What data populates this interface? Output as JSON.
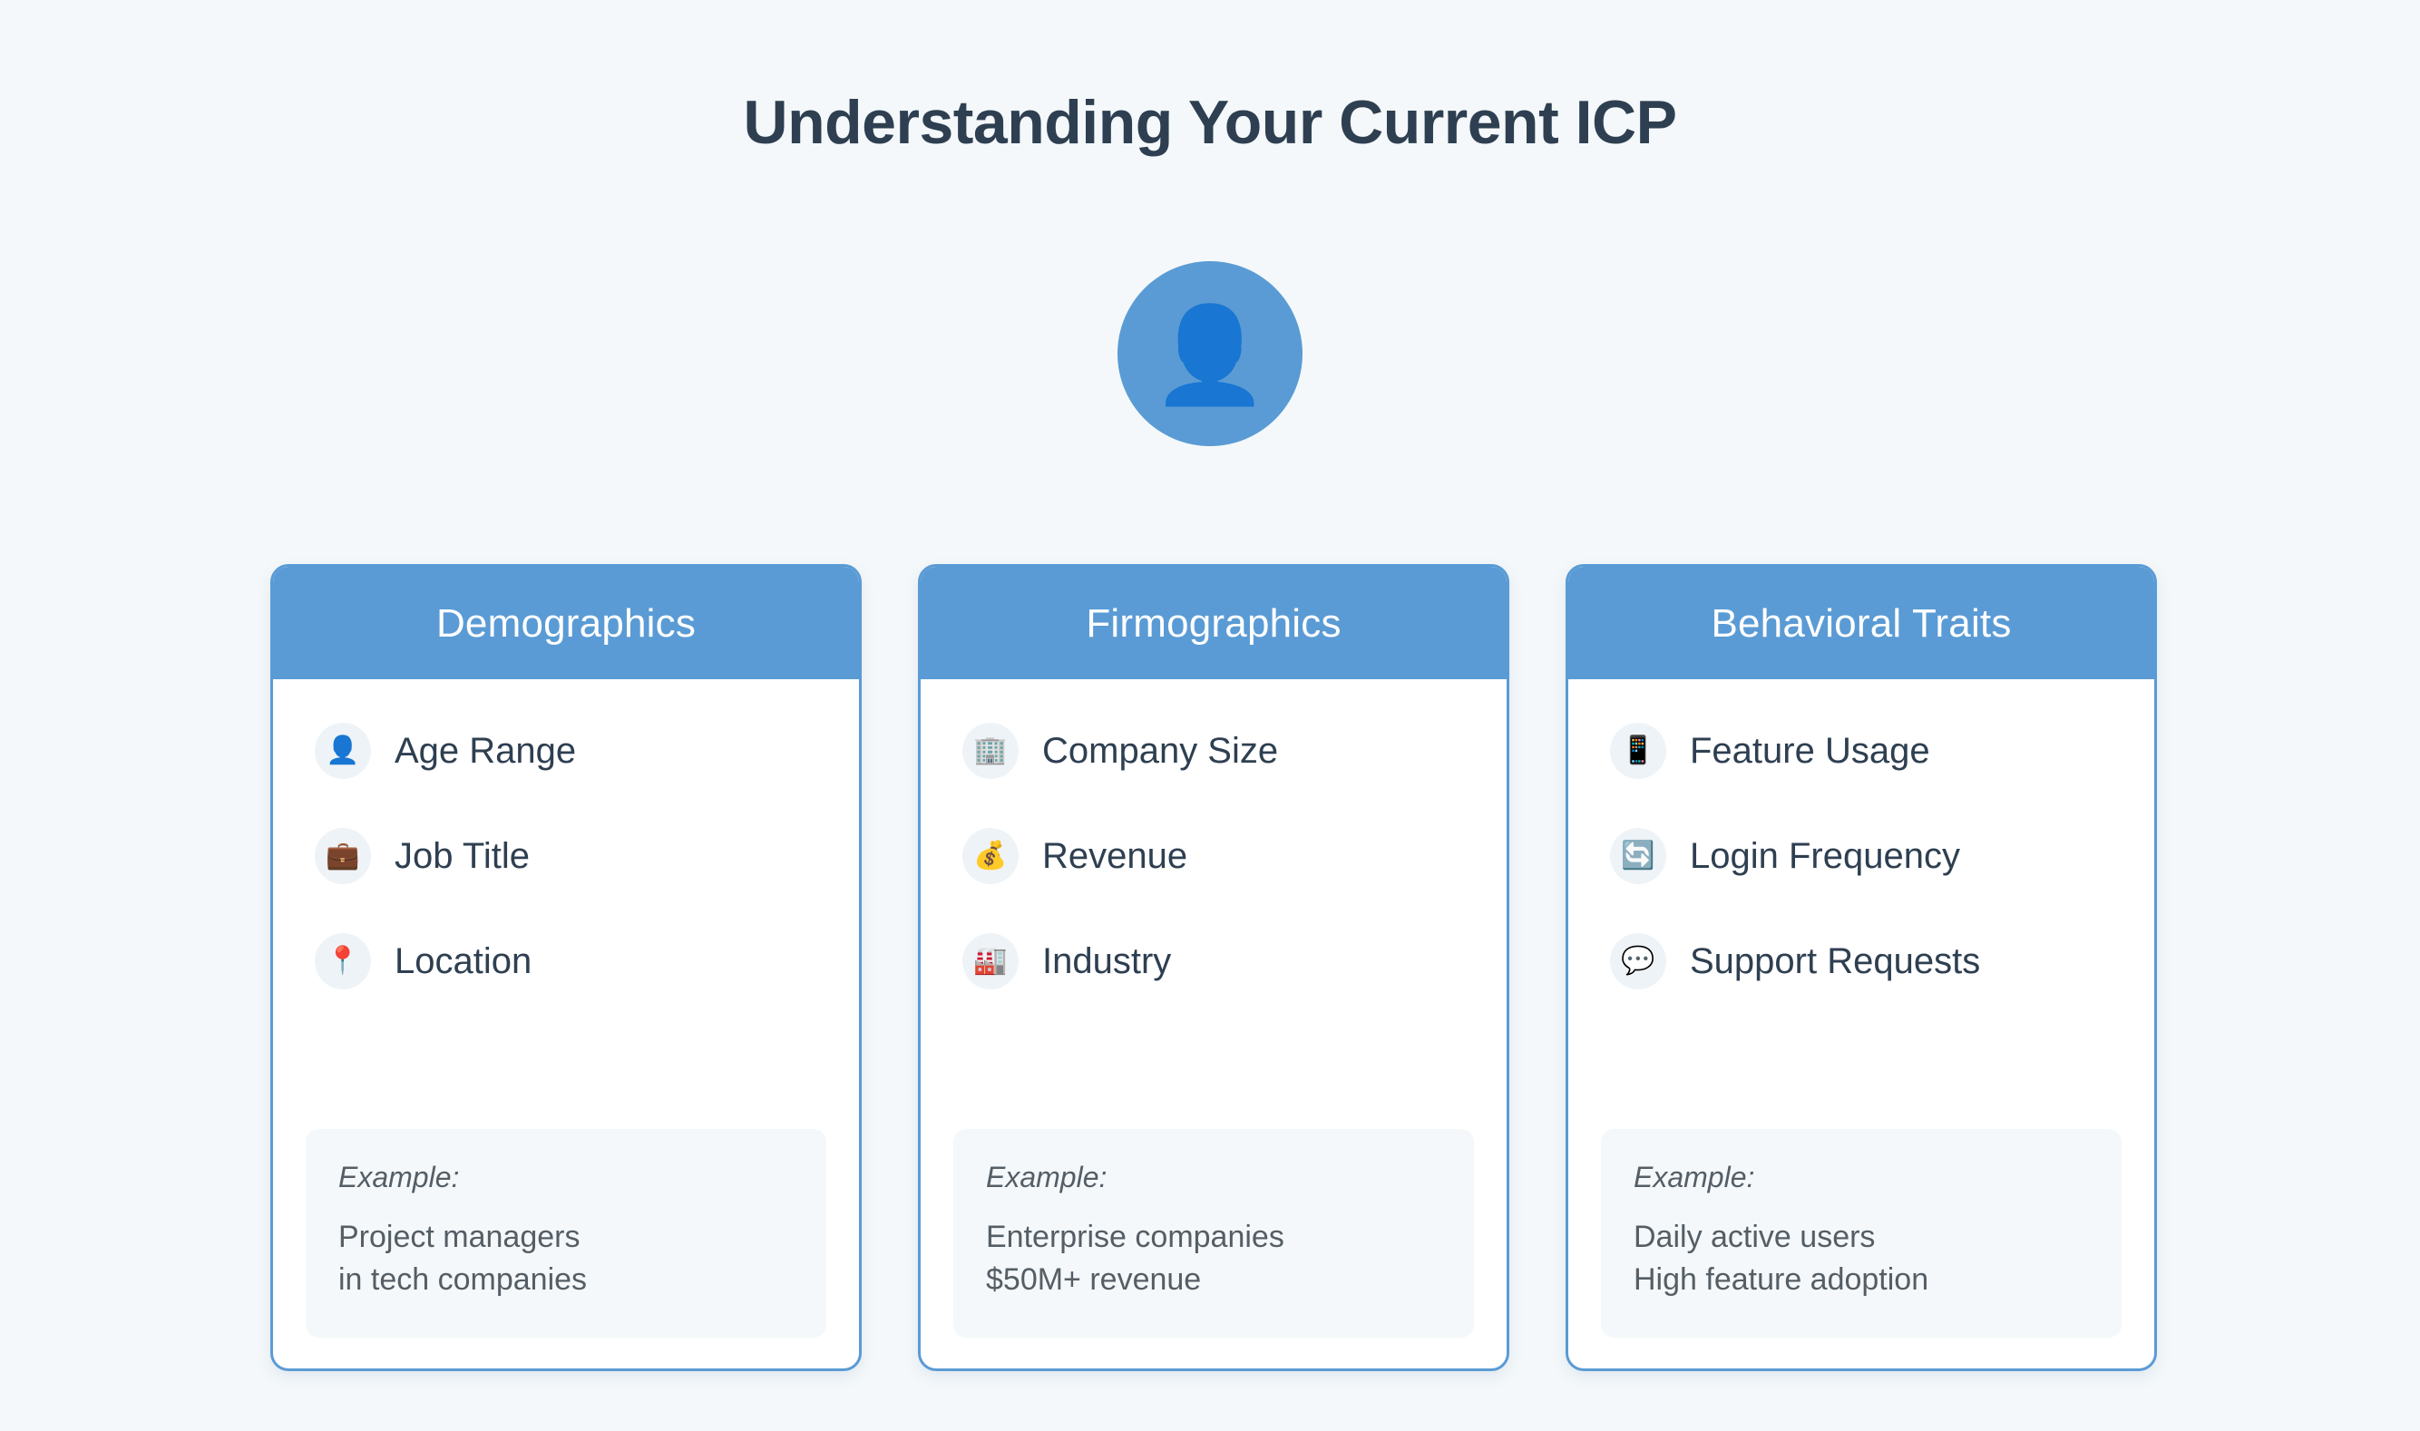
{
  "page": {
    "title": "Understanding Your Current ICP",
    "background_color": "#f4f8fa",
    "accent_color": "#5a9bd5",
    "title_color": "#2e3f51"
  },
  "avatar": {
    "icon": "bust-in-silhouette",
    "glyph": "👤",
    "background_color": "#5a9bd5"
  },
  "cards": [
    {
      "header": "Demographics",
      "items": [
        {
          "icon": "person-icon",
          "glyph": "👤",
          "label": "Age Range"
        },
        {
          "icon": "briefcase-icon",
          "glyph": "💼",
          "label": "Job Title"
        },
        {
          "icon": "pushpin-icon",
          "glyph": "📍",
          "label": "Location"
        }
      ],
      "example": {
        "label": "Example:",
        "lines": [
          "Project managers",
          "in tech companies"
        ]
      }
    },
    {
      "header": "Firmographics",
      "items": [
        {
          "icon": "office-building-icon",
          "glyph": "🏢",
          "label": "Company Size"
        },
        {
          "icon": "money-bag-icon",
          "glyph": "💰",
          "label": "Revenue"
        },
        {
          "icon": "factory-icon",
          "glyph": "🏭",
          "label": "Industry"
        }
      ],
      "example": {
        "label": "Example:",
        "lines": [
          "Enterprise companies",
          "$50M+ revenue"
        ]
      }
    },
    {
      "header": "Behavioral Traits",
      "items": [
        {
          "icon": "mobile-phone-icon",
          "glyph": "📱",
          "label": "Feature Usage"
        },
        {
          "icon": "refresh-icon",
          "glyph": "🔄",
          "label": "Login Frequency"
        },
        {
          "icon": "speech-balloon-icon",
          "glyph": "💬",
          "label": "Support Requests"
        }
      ],
      "example": {
        "label": "Example:",
        "lines": [
          "Daily active users",
          "High feature adoption"
        ]
      }
    }
  ]
}
